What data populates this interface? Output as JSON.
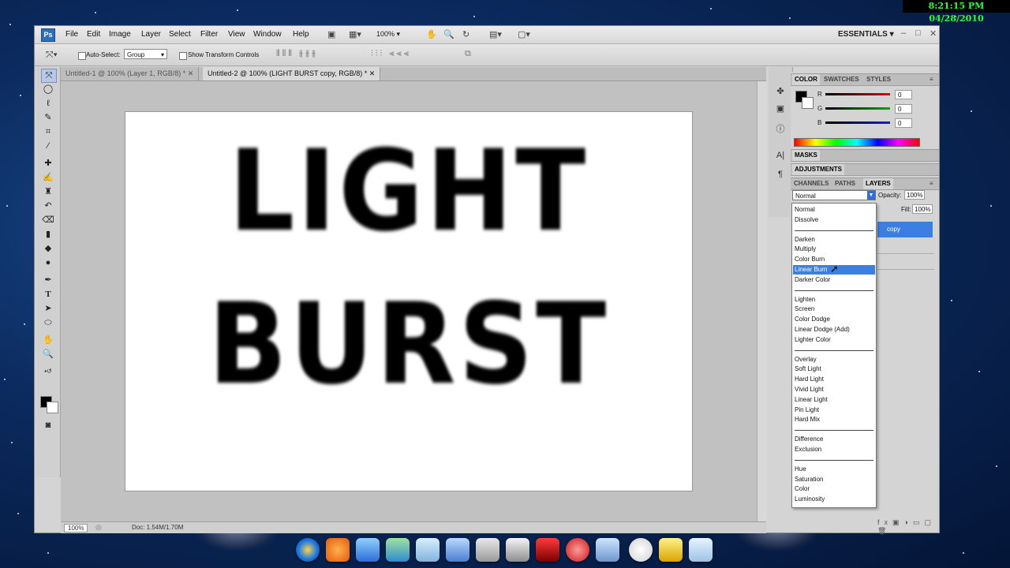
{
  "desktop": {
    "clock": "8:21:15 PM 04/28/2010"
  },
  "app": {
    "logo": "Ps",
    "menu": [
      "File",
      "Edit",
      "Image",
      "Layer",
      "Select",
      "Filter",
      "View",
      "Window",
      "Help"
    ],
    "zoom": "100%",
    "workspace": "ESSENTIALS"
  },
  "options": {
    "auto_select_label": "Auto-Select:",
    "auto_select_value": "Group",
    "show_transform_label": "Show Transform Controls"
  },
  "tabs": [
    {
      "label": "Untitled-1 @ 100% (Layer 1, RGB/8) *"
    },
    {
      "label": "Untitled-2 @ 100% (LIGHT BURST copy, RGB/8) *"
    }
  ],
  "document": {
    "line1": "LIGHT",
    "line2": "BURST"
  },
  "status": {
    "zoom": "100%",
    "doc": "Doc: 1.54M/1.70M"
  },
  "color_panel": {
    "tabs": [
      "COLOR",
      "SWATCHES",
      "STYLES"
    ],
    "channels": [
      {
        "label": "R",
        "value": "0"
      },
      {
        "label": "G",
        "value": "0"
      },
      {
        "label": "B",
        "value": "0"
      }
    ],
    "slider_colors": [
      "#d01010",
      "#10a010",
      "#1020c0"
    ]
  },
  "masks_panel": {
    "title": "MASKS"
  },
  "adjustments_panel": {
    "title": "ADJUSTMENTS"
  },
  "layers_panel": {
    "tabs": [
      "CHANNELS",
      "PATHS",
      "LAYERS"
    ],
    "blend_mode": "Normal",
    "opacity_label": "Opacity:",
    "opacity_value": "100%",
    "fill_label": "Fill:",
    "fill_value": "100%",
    "selected_layer_partial": "copy"
  },
  "blend_menu": {
    "groups": [
      [
        "Normal",
        "Dissolve"
      ],
      [
        "Darken",
        "Multiply",
        "Color Burn",
        "Linear Burn",
        "Darker Color"
      ],
      [
        "Lighten",
        "Screen",
        "Color Dodge",
        "Linear Dodge (Add)",
        "Lighter Color"
      ],
      [
        "Overlay",
        "Soft Light",
        "Hard Light",
        "Vivid Light",
        "Linear Light",
        "Pin Light",
        "Hard Mix"
      ],
      [
        "Difference",
        "Exclusion"
      ],
      [
        "Hue",
        "Saturation",
        "Color",
        "Luminosity"
      ]
    ],
    "highlighted": "Linear Burn"
  }
}
